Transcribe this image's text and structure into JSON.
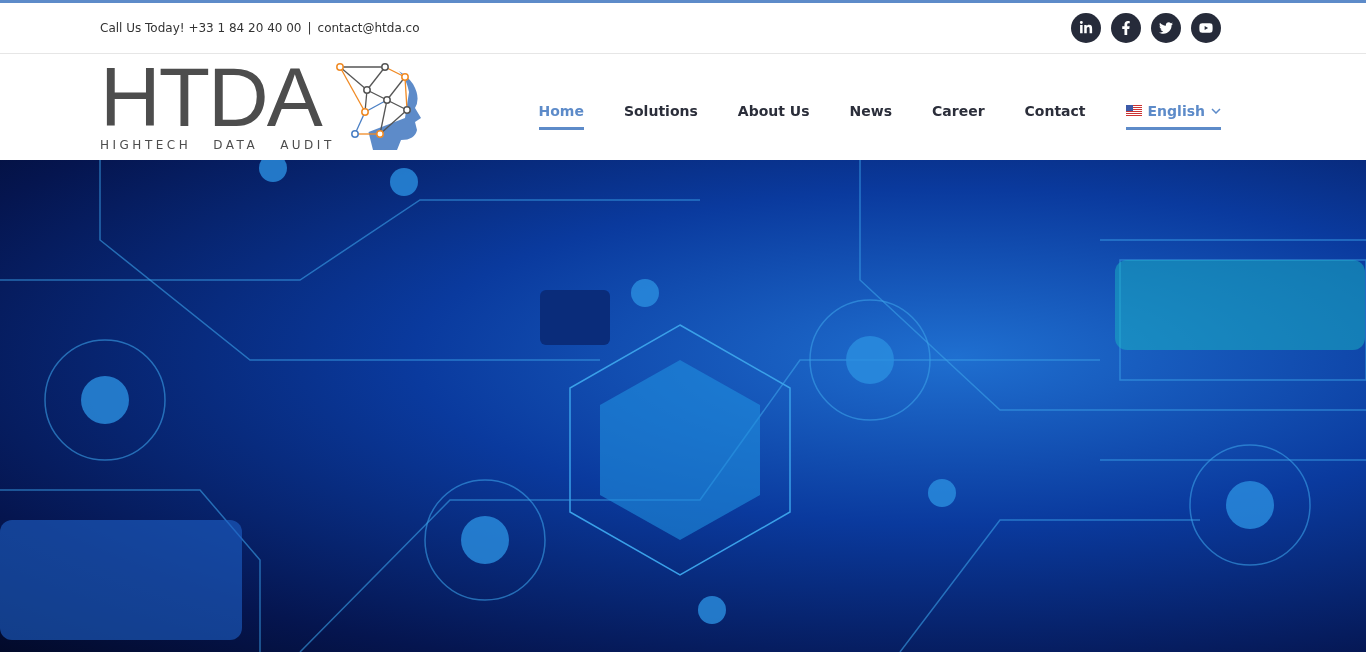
{
  "top_bar": {
    "contact_text": "Call Us Today! +33 1 84 20 40 00",
    "separator": "|",
    "email": "contact@htda.co"
  },
  "logo": {
    "letters": "HTDA",
    "tagline": [
      "HIGHTECH",
      "DATA",
      "AUDIT"
    ]
  },
  "nav": [
    {
      "label": "Home",
      "kind": "link",
      "selected": true
    },
    {
      "label": "Solutions",
      "kind": "link",
      "selected": false
    },
    {
      "label": "About Us",
      "kind": "link",
      "selected": false
    },
    {
      "label": "News",
      "kind": "link",
      "selected": false
    },
    {
      "label": "Career",
      "kind": "link",
      "selected": false
    },
    {
      "label": "Contact",
      "kind": "link",
      "selected": false
    },
    {
      "label": "English",
      "kind": "language",
      "selected": true
    }
  ]
}
